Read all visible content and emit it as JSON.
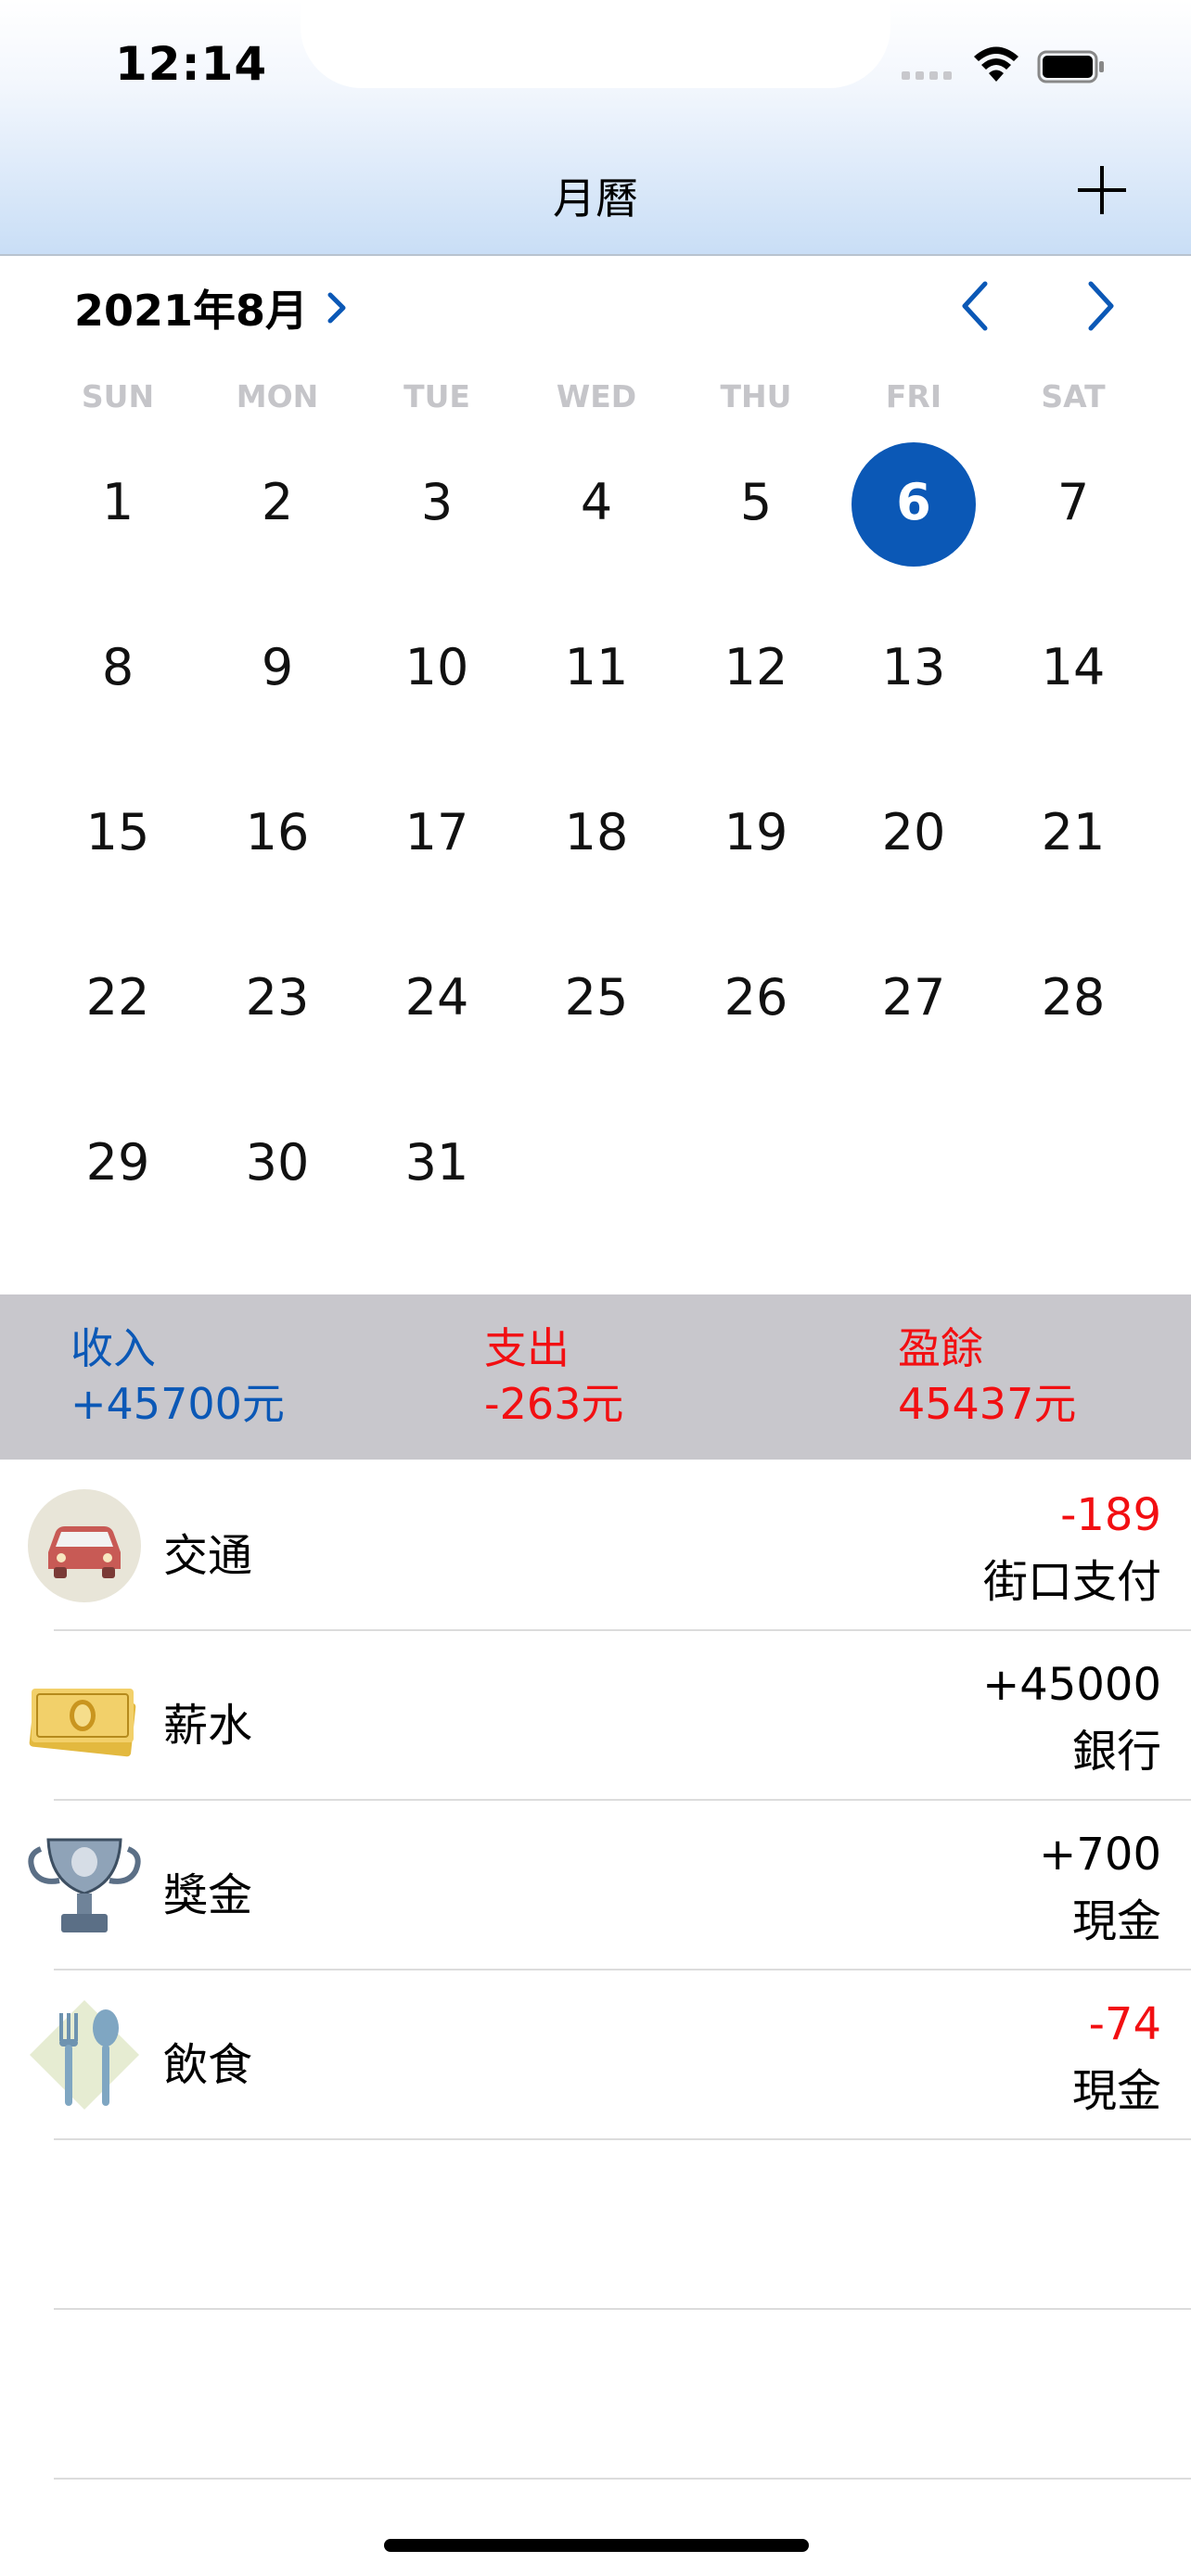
{
  "status_bar": {
    "time": "12:14"
  },
  "nav": {
    "title": "月曆"
  },
  "calendar": {
    "month_label": "2021年8月",
    "weekdays": [
      "SUN",
      "MON",
      "TUE",
      "WED",
      "THU",
      "FRI",
      "SAT"
    ],
    "selected_day": "6",
    "days": [
      "1",
      "2",
      "3",
      "4",
      "5",
      "6",
      "7",
      "8",
      "9",
      "10",
      "11",
      "12",
      "13",
      "14",
      "15",
      "16",
      "17",
      "18",
      "19",
      "20",
      "21",
      "22",
      "23",
      "24",
      "25",
      "26",
      "27",
      "28",
      "29",
      "30",
      "31"
    ]
  },
  "summary": {
    "income_label": "收入",
    "income_value": "+45700元",
    "expense_label": "支出",
    "expense_value": "-263元",
    "balance_label": "盈餘",
    "balance_value": "45437元"
  },
  "transactions": [
    {
      "name": "交通",
      "amount": "-189",
      "account": "街口支付",
      "icon": "car-icon",
      "amount_color": "#f20f12"
    },
    {
      "name": "薪水",
      "amount": "+45000",
      "account": "銀行",
      "icon": "cash-icon",
      "amount_color": "#000000"
    },
    {
      "name": "獎金",
      "amount": "+700",
      "account": "現金",
      "icon": "trophy-icon",
      "amount_color": "#000000"
    },
    {
      "name": "飲食",
      "amount": "-74",
      "account": "現金",
      "icon": "fork-spoon-icon",
      "amount_color": "#f20f12"
    }
  ],
  "colors": {
    "accent": "#0b58b6",
    "negative": "#f20f12",
    "summary_bg": "#c8c7cc"
  }
}
